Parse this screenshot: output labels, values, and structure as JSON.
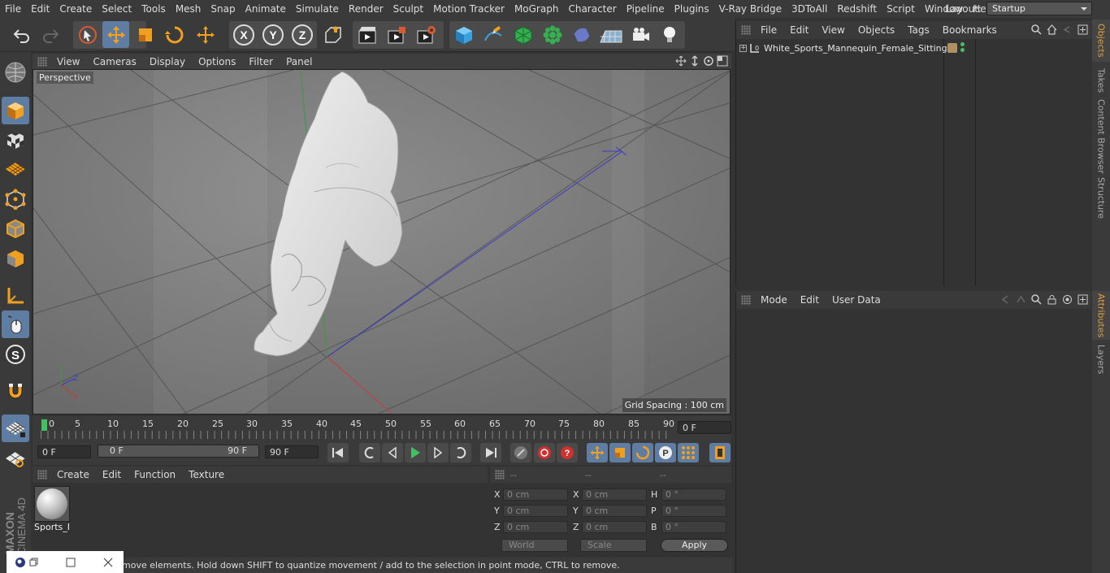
{
  "menu": [
    "File",
    "Edit",
    "Create",
    "Select",
    "Tools",
    "Mesh",
    "Snap",
    "Animate",
    "Simulate",
    "Render",
    "Sculpt",
    "Motion Tracker",
    "MoGraph",
    "Character",
    "Pipeline",
    "Plugins",
    "V-Ray Bridge",
    "3DToAll",
    "Redshift",
    "Script",
    "Window",
    "Help"
  ],
  "layout": {
    "label": "Layout:",
    "value": "Startup"
  },
  "toolbar": {
    "undo": "undo-icon",
    "redo": "redo-icon",
    "axis_x": "X",
    "axis_y": "Y",
    "axis_z": "Z"
  },
  "viewport": {
    "menu": [
      "View",
      "Cameras",
      "Display",
      "Options",
      "Filter",
      "Panel"
    ],
    "label": "Perspective",
    "grid_spacing": "Grid Spacing : 100 cm"
  },
  "timeline": {
    "ticks": [
      "0",
      "5",
      "10",
      "15",
      "20",
      "25",
      "30",
      "35",
      "40",
      "45",
      "50",
      "55",
      "60",
      "65",
      "70",
      "75",
      "80",
      "85",
      "90"
    ],
    "current_frame": "0 F"
  },
  "playback": {
    "start": "0 F",
    "range_start": "0 F",
    "range_end": "90 F",
    "end": "90 F"
  },
  "materials": {
    "menu": [
      "Create",
      "Edit",
      "Function",
      "Texture"
    ],
    "items": [
      {
        "name": "Sports_I"
      }
    ]
  },
  "coords": {
    "headers": [
      "--",
      "--",
      "--"
    ],
    "rows": [
      {
        "l1": "X",
        "v1": "0 cm",
        "l2": "X",
        "v2": "0 cm",
        "l3": "H",
        "v3": "0 °"
      },
      {
        "l1": "Y",
        "v1": "0 cm",
        "l2": "Y",
        "v2": "0 cm",
        "l3": "P",
        "v3": "0 °"
      },
      {
        "l1": "Z",
        "v1": "0 cm",
        "l2": "Z",
        "v2": "0 cm",
        "l3": "B",
        "v3": "0 °"
      }
    ],
    "mode": "World",
    "scale": "Scale",
    "apply": "Apply"
  },
  "status": "move elements. Hold down SHIFT to quantize movement / add to the selection in point mode, CTRL to remove.",
  "objects": {
    "menu": [
      "File",
      "Edit",
      "View",
      "Objects",
      "Tags",
      "Bookmarks"
    ],
    "items": [
      {
        "name": "White_Sports_Mannequin_Female_Sitting"
      }
    ]
  },
  "attributes": {
    "menu": [
      "Mode",
      "Edit",
      "User Data"
    ]
  },
  "side_tabs": [
    "Objects",
    "Takes",
    "Content Browser",
    "Structure",
    "Attributes",
    "Layers"
  ],
  "brand": {
    "line1": "MAXON",
    "line2": "CINEMA 4D"
  },
  "colors": {
    "accent": "#5f7da3",
    "orange": "#e0a040"
  }
}
